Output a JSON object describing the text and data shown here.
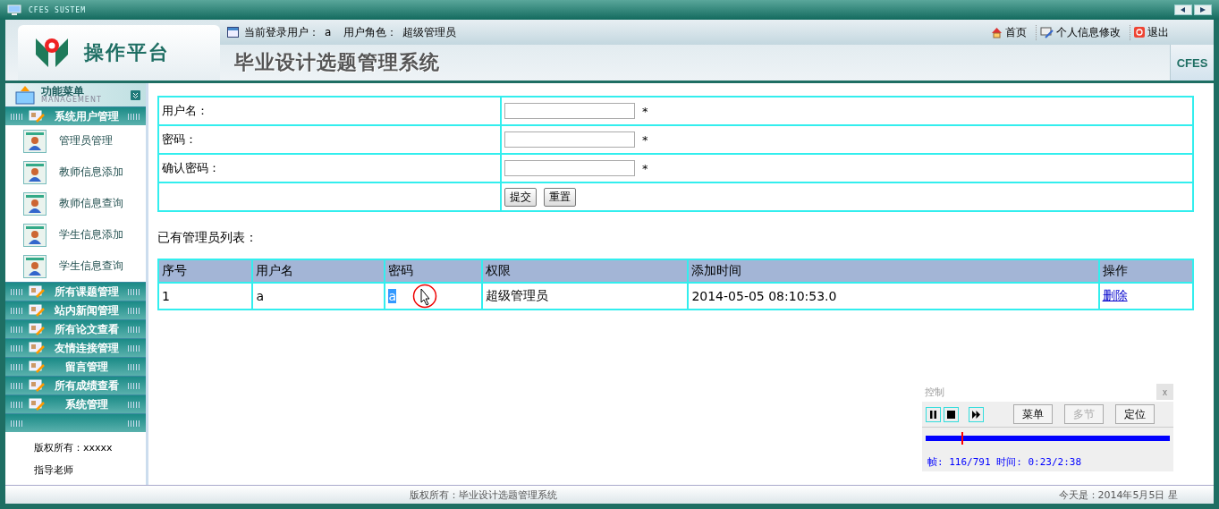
{
  "window": {
    "title": "CFES SUSTEM"
  },
  "header": {
    "logo_text": "操作平台",
    "login_user_label": "当前登录用户：",
    "login_user": "a",
    "role_label": "用户角色：",
    "role": "超级管理员",
    "system_title": "毕业设计选题管理系统",
    "brand": "CFES",
    "links": [
      {
        "label": "首页",
        "kind": "home"
      },
      {
        "label": "个人信息修改",
        "kind": "edit"
      },
      {
        "label": "退出",
        "kind": "exit"
      }
    ]
  },
  "sidebar": {
    "title": "功能菜单",
    "subtitle": "MANAGEMENT",
    "groups": [
      {
        "label": "系统用户管理",
        "items": [
          "管理员管理",
          "教师信息添加",
          "教师信息查询",
          "学生信息添加",
          "学生信息查询"
        ]
      },
      {
        "label": "所有课题管理"
      },
      {
        "label": "站内新闻管理"
      },
      {
        "label": "所有论文查看"
      },
      {
        "label": "友情连接管理"
      },
      {
        "label": "留言管理"
      },
      {
        "label": "所有成绩查看"
      },
      {
        "label": "系统管理"
      }
    ],
    "notes": [
      "版权所有：xxxxx",
      "指导老师"
    ]
  },
  "form": {
    "fields": [
      {
        "label": "用户名：",
        "required_mark": "*"
      },
      {
        "label": "密码：",
        "required_mark": "*"
      },
      {
        "label": "确认密码：",
        "required_mark": "*"
      }
    ],
    "buttons": [
      "提交",
      "重置"
    ]
  },
  "list_title": "已有管理员列表：",
  "table": {
    "columns": [
      "序号",
      "用户名",
      "密码",
      "权限",
      "添加时间",
      "操作"
    ],
    "rows": [
      {
        "cells": [
          {
            "text": "1",
            "kind": "text",
            "highlighted": false
          },
          {
            "text": "a",
            "kind": "text",
            "highlighted": false
          },
          {
            "text": "a",
            "kind": "text",
            "highlighted": true
          },
          {
            "text": "超级管理员",
            "kind": "text",
            "highlighted": false
          },
          {
            "text": "2014-05-05 08:10:53.0",
            "kind": "text",
            "highlighted": false
          },
          {
            "text": "删除",
            "kind": "link",
            "highlighted": false
          }
        ]
      }
    ]
  },
  "player": {
    "title": "控制",
    "close": "x",
    "level": 0.147,
    "status": "帧: 116/791 时间: 0:23/2:38",
    "buttons": [
      {
        "label": "菜单",
        "disabled": false
      },
      {
        "label": "多节",
        "disabled": true
      },
      {
        "label": "定位",
        "disabled": false
      }
    ]
  },
  "status_bar": {
    "copyright": "版权所有：毕业设计选题管理系统",
    "date": "今天是：2014年5月5日 星"
  }
}
